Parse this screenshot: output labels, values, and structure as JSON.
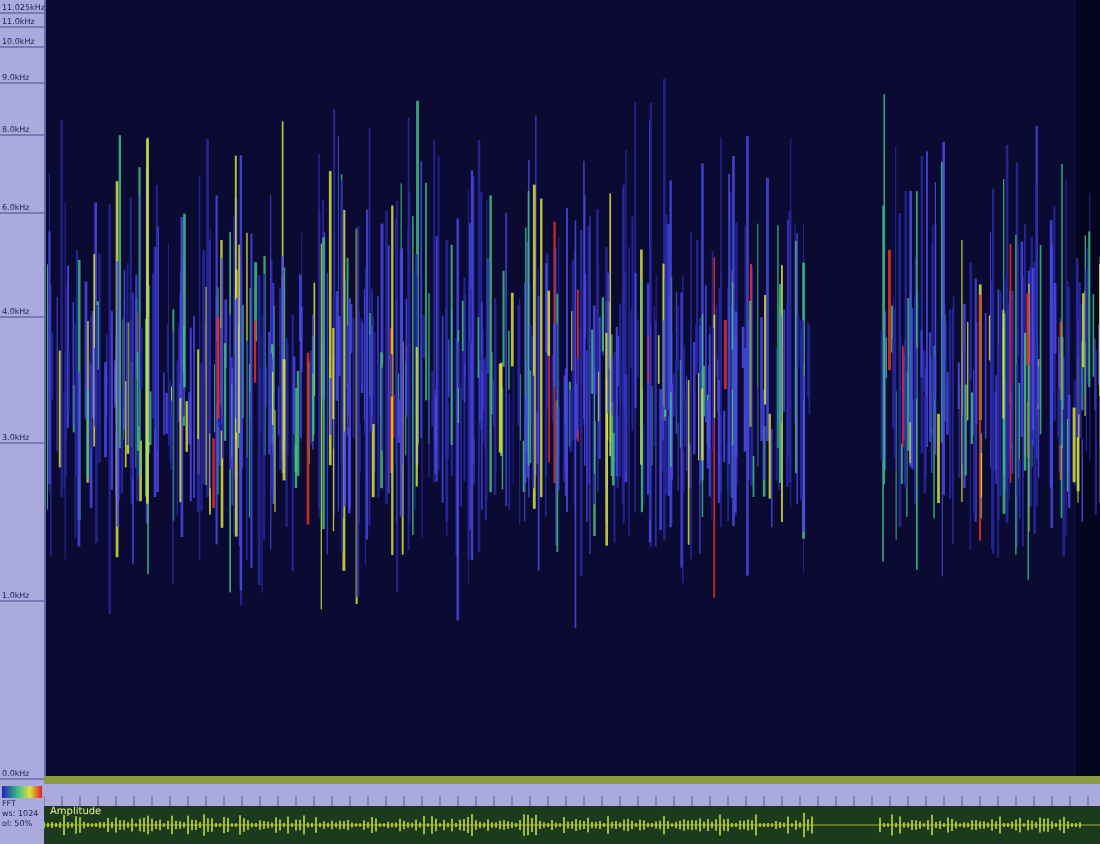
{
  "frequency_axis": {
    "labels": [
      "11.025kHz",
      "11.0kHz",
      "10.0kHz",
      "9.0kHz",
      "8.0kHz",
      "6.0kHz",
      "4.0kHz",
      "3.0kHz",
      "1.0kHz",
      "0.0kHz"
    ]
  },
  "waveform": {
    "label": "Amplitude"
  },
  "info": [
    "FFT",
    "ws: 1024",
    "ol: 50%"
  ]
}
